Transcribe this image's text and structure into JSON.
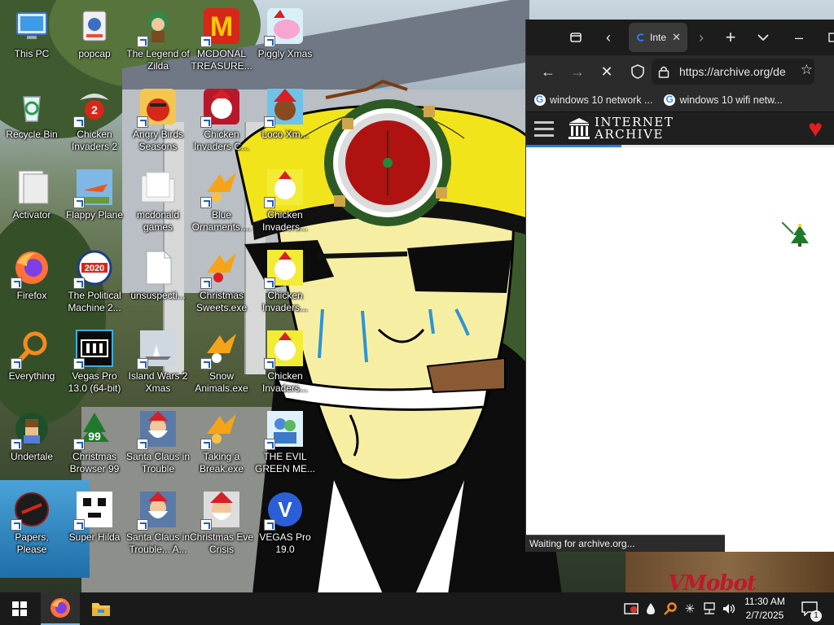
{
  "desktop": {
    "icons": [
      {
        "label": "This PC",
        "icon": "this-pc-icon",
        "shortcut": false
      },
      {
        "label": "popcap",
        "icon": "popcap-icon",
        "shortcut": false
      },
      {
        "label": "The Legend of Zilda",
        "icon": "legend-zilda-icon",
        "shortcut": true
      },
      {
        "label": "MCDONAL TREASURE...",
        "icon": "mcdonald-logo-icon",
        "shortcut": true
      },
      {
        "label": "Piggly Xmas",
        "icon": "piggly-xmas-icon",
        "shortcut": true
      },
      {
        "label": "Recycle Bin",
        "icon": "recycle-bin-icon",
        "shortcut": false
      },
      {
        "label": "Chicken Invaders 2",
        "icon": "chicken-invaders-2-icon",
        "shortcut": true
      },
      {
        "label": "Angry Birds Seasons",
        "icon": "angry-birds-icon",
        "shortcut": true
      },
      {
        "label": "Chicken Invaders C...",
        "icon": "chicken-invaders-c-icon",
        "shortcut": true
      },
      {
        "label": "Loco Xm...",
        "icon": "loco-xmas-icon",
        "shortcut": true
      },
      {
        "label": "Activator",
        "icon": "activator-icon",
        "shortcut": false
      },
      {
        "label": "Flappy Plane",
        "icon": "flappy-plane-icon",
        "shortcut": true
      },
      {
        "label": "mcdonald games",
        "icon": "folder-icon",
        "shortcut": false
      },
      {
        "label": "Blue Ornaments....",
        "icon": "ornaments-icon",
        "shortcut": true
      },
      {
        "label": "Chicken Invaders...",
        "icon": "chicken-invaders-icon",
        "shortcut": true
      },
      {
        "label": "Firefox",
        "icon": "firefox-icon",
        "shortcut": true
      },
      {
        "label": "The Political Machine 2...",
        "icon": "political-machine-icon",
        "shortcut": true
      },
      {
        "label": "unsuspecti...",
        "icon": "file-icon",
        "shortcut": false
      },
      {
        "label": "Christmas Sweets.exe",
        "icon": "christmas-sweets-icon",
        "shortcut": true
      },
      {
        "label": "Chicken Invaders...",
        "icon": "chicken-invaders-icon",
        "shortcut": true
      },
      {
        "label": "Everything",
        "icon": "everything-search-icon",
        "shortcut": true
      },
      {
        "label": "Vegas Pro 13.0 (64-bit)",
        "icon": "vegas-pro-13-icon",
        "shortcut": true
      },
      {
        "label": "Island Wars 2 Xmas",
        "icon": "island-wars-icon",
        "shortcut": true
      },
      {
        "label": "Snow Animals.exe",
        "icon": "snow-animals-icon",
        "shortcut": true
      },
      {
        "label": "Chicken Invaders...",
        "icon": "chicken-invaders-icon",
        "shortcut": true
      },
      {
        "label": "Undertale",
        "icon": "undertale-icon",
        "shortcut": true
      },
      {
        "label": "Christmas Browser 99",
        "icon": "christmas-browser-icon",
        "shortcut": true
      },
      {
        "label": "Santa Claus in Trouble",
        "icon": "santa-claus-icon",
        "shortcut": true
      },
      {
        "label": "Taking a Break.exe",
        "icon": "taking-break-icon",
        "shortcut": true
      },
      {
        "label": "THE EVIL GREEN ME...",
        "icon": "evil-green-icon",
        "shortcut": true
      },
      {
        "label": "Papers, Please",
        "icon": "papers-please-icon",
        "shortcut": true
      },
      {
        "label": "Super Hilda",
        "icon": "super-hilda-icon",
        "shortcut": true
      },
      {
        "label": "Santa Claus in Trouble... A...",
        "icon": "santa-claus-icon",
        "shortcut": true
      },
      {
        "label": "Christmas Eve Crisis",
        "icon": "christmas-eve-icon",
        "shortcut": true
      },
      {
        "label": "VEGAS Pro 19.0",
        "icon": "vegas-pro-19-icon",
        "shortcut": true
      }
    ],
    "mcdonald_glyph": "M",
    "political_badge": "2020",
    "browser99_badge": "99",
    "chicken2_badge": "2",
    "vegas19_glyph": "V",
    "wallpaper_sign": "VMobot"
  },
  "browser": {
    "tab_title": "Inte",
    "url": "https://archive.org/de",
    "bookmarks": [
      "windows 10 network ...",
      "windows 10 wifi netw..."
    ],
    "site_logo_line1": "INTERNET",
    "site_logo_line2": "ARCHIVE",
    "progress": 0.31,
    "status": "Waiting for archive.org..."
  },
  "taskbar": {
    "time": "11:30 AM",
    "date": "2/7/2025",
    "notification_count": "1"
  },
  "colors": {
    "accent": "#2d7be5",
    "heart": "#e01f1f",
    "taskbar": "#1a1a1a"
  }
}
